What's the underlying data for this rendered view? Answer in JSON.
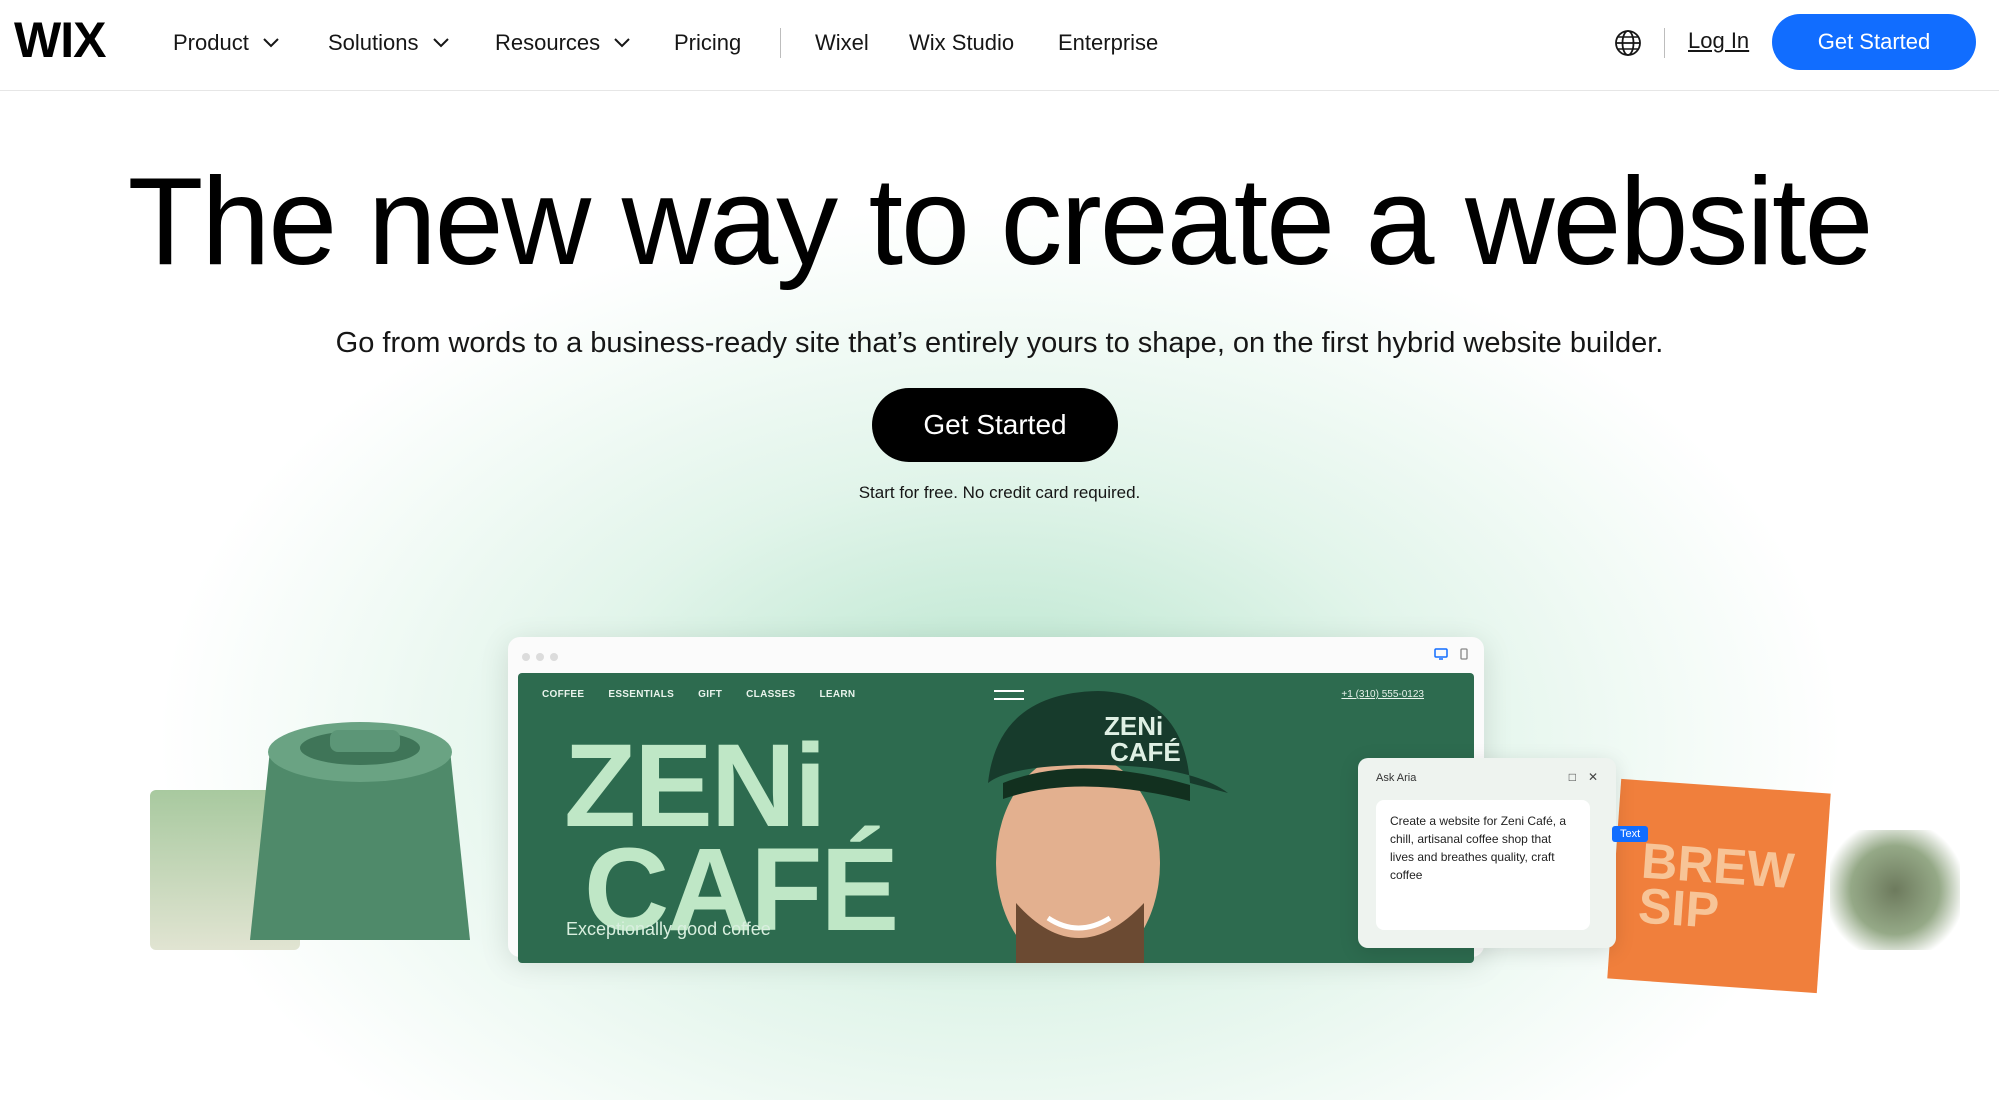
{
  "nav": {
    "logo": "WIX",
    "items": [
      {
        "label": "Product"
      },
      {
        "label": "Solutions"
      },
      {
        "label": "Resources"
      },
      {
        "label": "Pricing"
      },
      {
        "label": "Wixel"
      },
      {
        "label": "Wix Studio"
      },
      {
        "label": "Enterprise"
      }
    ],
    "login_label": "Log In",
    "cta_label": "Get Started"
  },
  "hero": {
    "title": "The new way to create a website",
    "subtitle": "Go from words to a business-ready site that’s entirely yours to shape, on the first hybrid website builder.",
    "cta_label": "Get Started",
    "note": "Start for free. No credit card required."
  },
  "showcase": {
    "site_nav": [
      "COFFEE",
      "ESSENTIALS",
      "GIFT",
      "CLASSES",
      "LEARN"
    ],
    "site_phone": "+1 (310) 555-0123",
    "brand_line1": "ZENi",
    "brand_line2": "CAFÉ",
    "cap_logo_line1": "ZENi",
    "cap_logo_line2": "CAFÉ",
    "tagline": "Exceptionally good coffee",
    "ai_panel_title": "Ask Aria",
    "ai_prompt": "Create a website for Zeni Café, a chill, artisanal coffee shop that lives and breathes quality, craft coffee",
    "text_tag": "Text",
    "card_text_line1": "BREW",
    "card_text_line2": "SIP"
  },
  "colors": {
    "accent": "#116dff",
    "site_green": "#2d6b4f",
    "brand_mint": "#bfe7c6",
    "card_orange": "#f07f3c"
  }
}
